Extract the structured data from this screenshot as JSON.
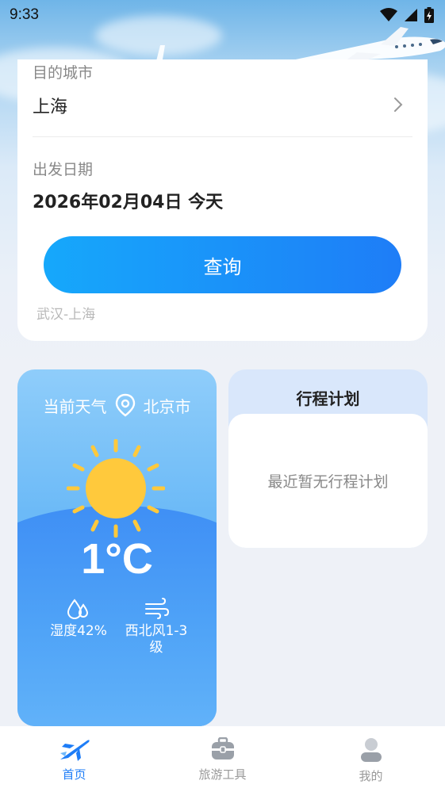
{
  "status_bar": {
    "time": "9:33"
  },
  "search_form": {
    "destination_label": "目的城市",
    "destination_value": "上海",
    "date_label": "出发日期",
    "date_value": "2026年02月04日 今天",
    "query_button": "查询",
    "history_route": "武汉-上海"
  },
  "weather": {
    "title": "当前天气",
    "location": "北京市",
    "temperature": "1°C",
    "humidity": "湿度42%",
    "wind": "西北风1-3级"
  },
  "trip_plan": {
    "title": "行程计划",
    "empty_text": "最近暂无行程计划"
  },
  "bottom_nav": {
    "items": [
      {
        "label": "首页",
        "icon": "plane-icon",
        "active": true
      },
      {
        "label": "旅游工具",
        "icon": "suitcase-icon",
        "active": false
      },
      {
        "label": "我的",
        "icon": "user-icon",
        "active": false
      }
    ]
  },
  "colors": {
    "accent": "#1e7df7",
    "button_gradient_start": "#16a8fb",
    "sun": "#ffc93c",
    "weather_card": "#6cbaf7",
    "plan_header": "#d9e7fb"
  }
}
